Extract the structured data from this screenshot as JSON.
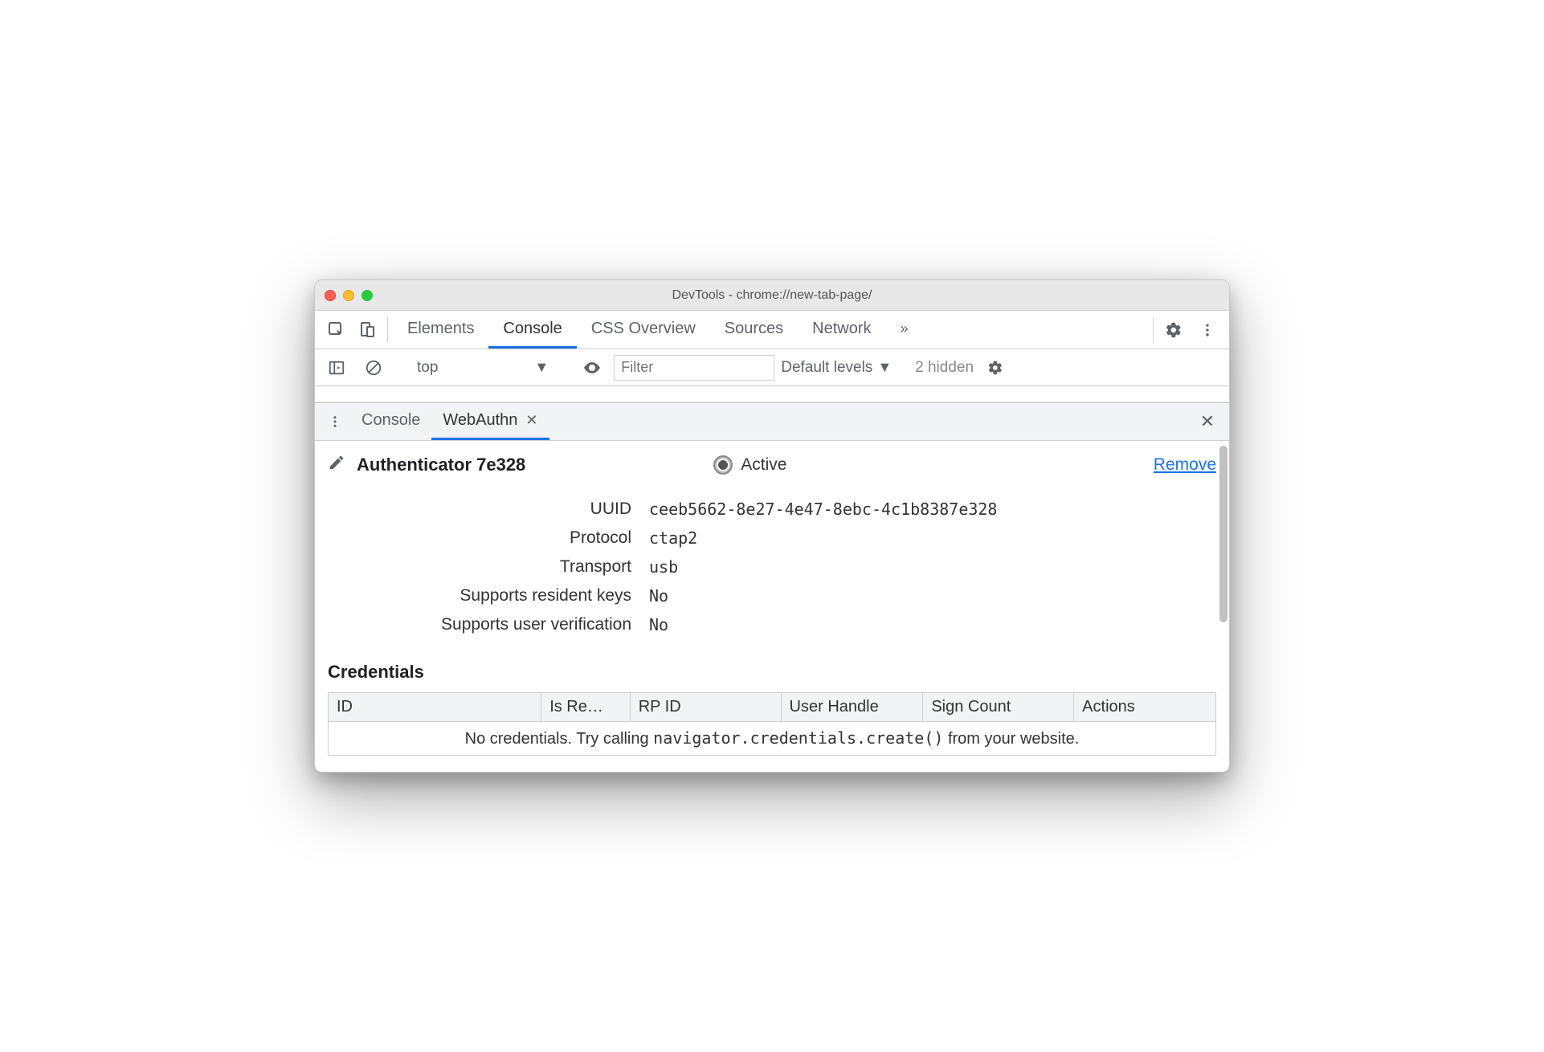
{
  "window": {
    "title": "DevTools - chrome://new-tab-page/"
  },
  "main_tabs": {
    "items": [
      "Elements",
      "Console",
      "CSS Overview",
      "Sources",
      "Network"
    ],
    "active_index": 1
  },
  "console_bar": {
    "context": "top",
    "filter_placeholder": "Filter",
    "levels_label": "Default levels",
    "hidden_label": "2 hidden"
  },
  "drawer_tabs": {
    "items": [
      "Console",
      "WebAuthn"
    ],
    "active_index": 1
  },
  "authenticator": {
    "title": "Authenticator 7e328",
    "active_label": "Active",
    "remove_label": "Remove",
    "props": {
      "uuid_label": "UUID",
      "uuid": "ceeb5662-8e27-4e47-8ebc-4c1b8387e328",
      "protocol_label": "Protocol",
      "protocol": "ctap2",
      "transport_label": "Transport",
      "transport": "usb",
      "resident_label": "Supports resident keys",
      "resident": "No",
      "userverif_label": "Supports user verification",
      "userverif": "No"
    }
  },
  "credentials": {
    "heading": "Credentials",
    "columns": [
      "ID",
      "Is Re…",
      "RP ID",
      "User Handle",
      "Sign Count",
      "Actions"
    ],
    "empty_prefix": "No credentials. Try calling ",
    "empty_code": "navigator.credentials.create()",
    "empty_suffix": " from your website."
  }
}
